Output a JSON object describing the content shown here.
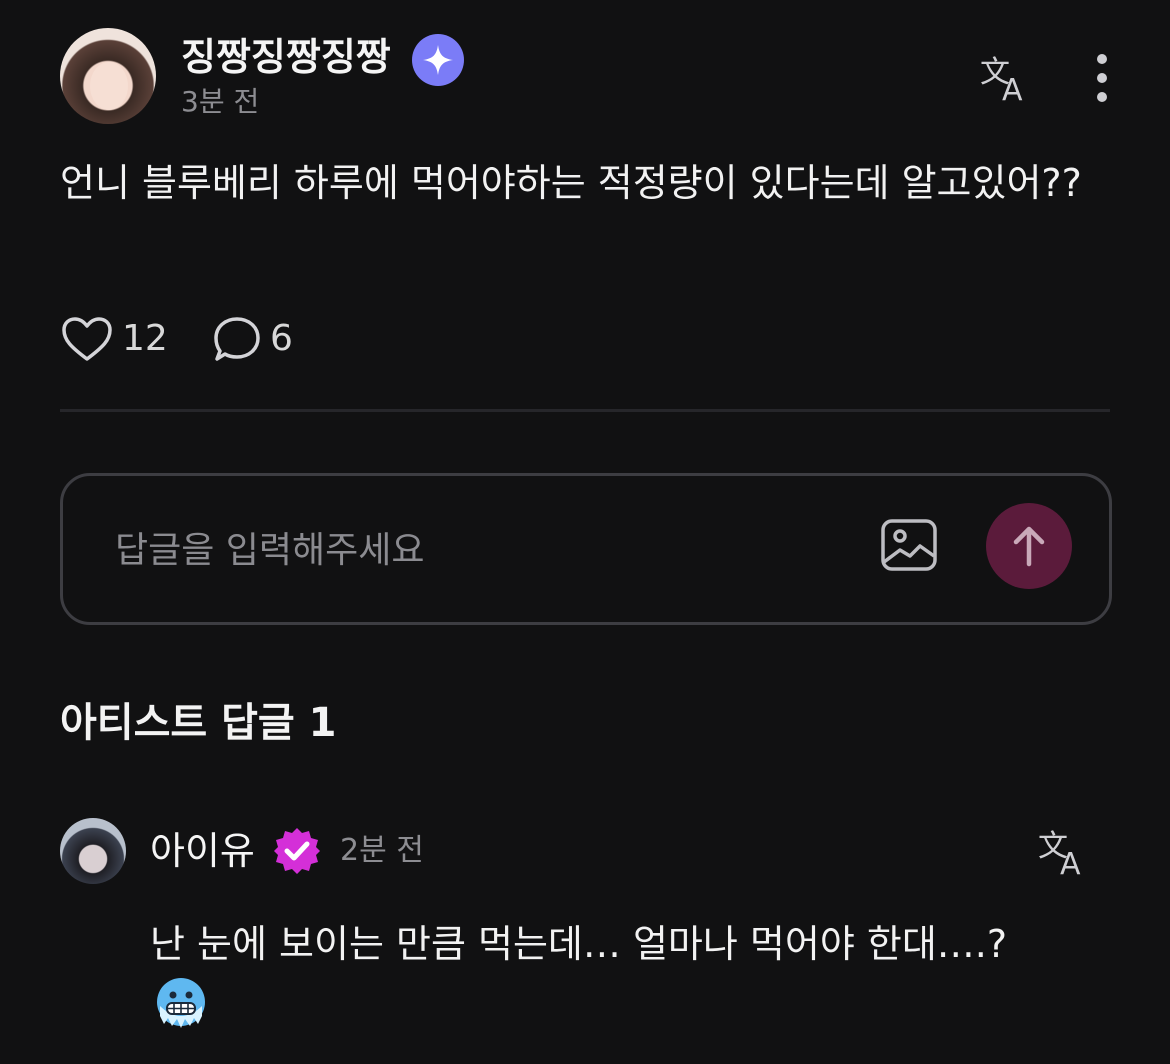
{
  "post": {
    "author_name": "징짱징짱징짱",
    "author_badge_icon": "sparkle-badge-icon",
    "time": "3분 전",
    "text": "언니 블루베리 하루에 먹어야하는 적정량이 있다는데 알고있어??",
    "like_count": "12",
    "comment_count": "6"
  },
  "reply_box": {
    "placeholder": "답글을 입력해주세요"
  },
  "artist_section": {
    "title": "아티스트 답글 1"
  },
  "artist_reply": {
    "name": "아이유",
    "badge_icon": "verified-check-icon",
    "time": "2분 전",
    "text": "난 눈에 보이는 만큼 먹는데… 얼마나 먹어야 한대….?",
    "emoji_icon": "cold-face-emoji-icon"
  },
  "colors": {
    "background": "#111112",
    "star_badge": "#7b7cf7",
    "verified_badge": "#d42fd8",
    "send_button": "#5b1b3b"
  }
}
